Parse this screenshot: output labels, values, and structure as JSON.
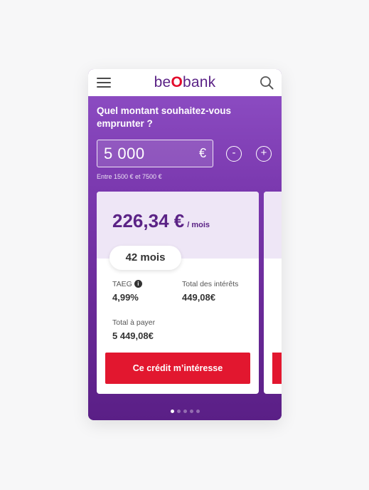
{
  "header": {
    "logo_pre": "be",
    "logo_o": "O",
    "logo_post": "bank",
    "menu_icon": "hamburger-menu-icon",
    "search_icon": "search-icon"
  },
  "loan_form": {
    "question": "Quel montant souhaitez-vous emprunter ?",
    "amount_value": "5 000",
    "currency": "€",
    "minus_label": "-",
    "plus_label": "+",
    "range_hint": "Entre 1500 € et 7500 €"
  },
  "offer_card": {
    "monthly_amount": "226,34 €",
    "monthly_unit": "/ mois",
    "duration": "42 mois",
    "taeg_label": "TAEG",
    "taeg_value": "4,99%",
    "interest_label": "Total des intérêts",
    "interest_value": "449,08€",
    "total_label": "Total à payer",
    "total_value": "5 449,08€",
    "cta_label": "Ce crédit m’intéresse",
    "info_icon": "info-icon"
  },
  "carousel": {
    "dot_count": 5,
    "active_index": 0
  },
  "colors": {
    "brand_purple": "#5b2386",
    "hero_purple": "#7a38ae",
    "cta_red": "#e2172f",
    "card_tint": "#eee6f6"
  }
}
